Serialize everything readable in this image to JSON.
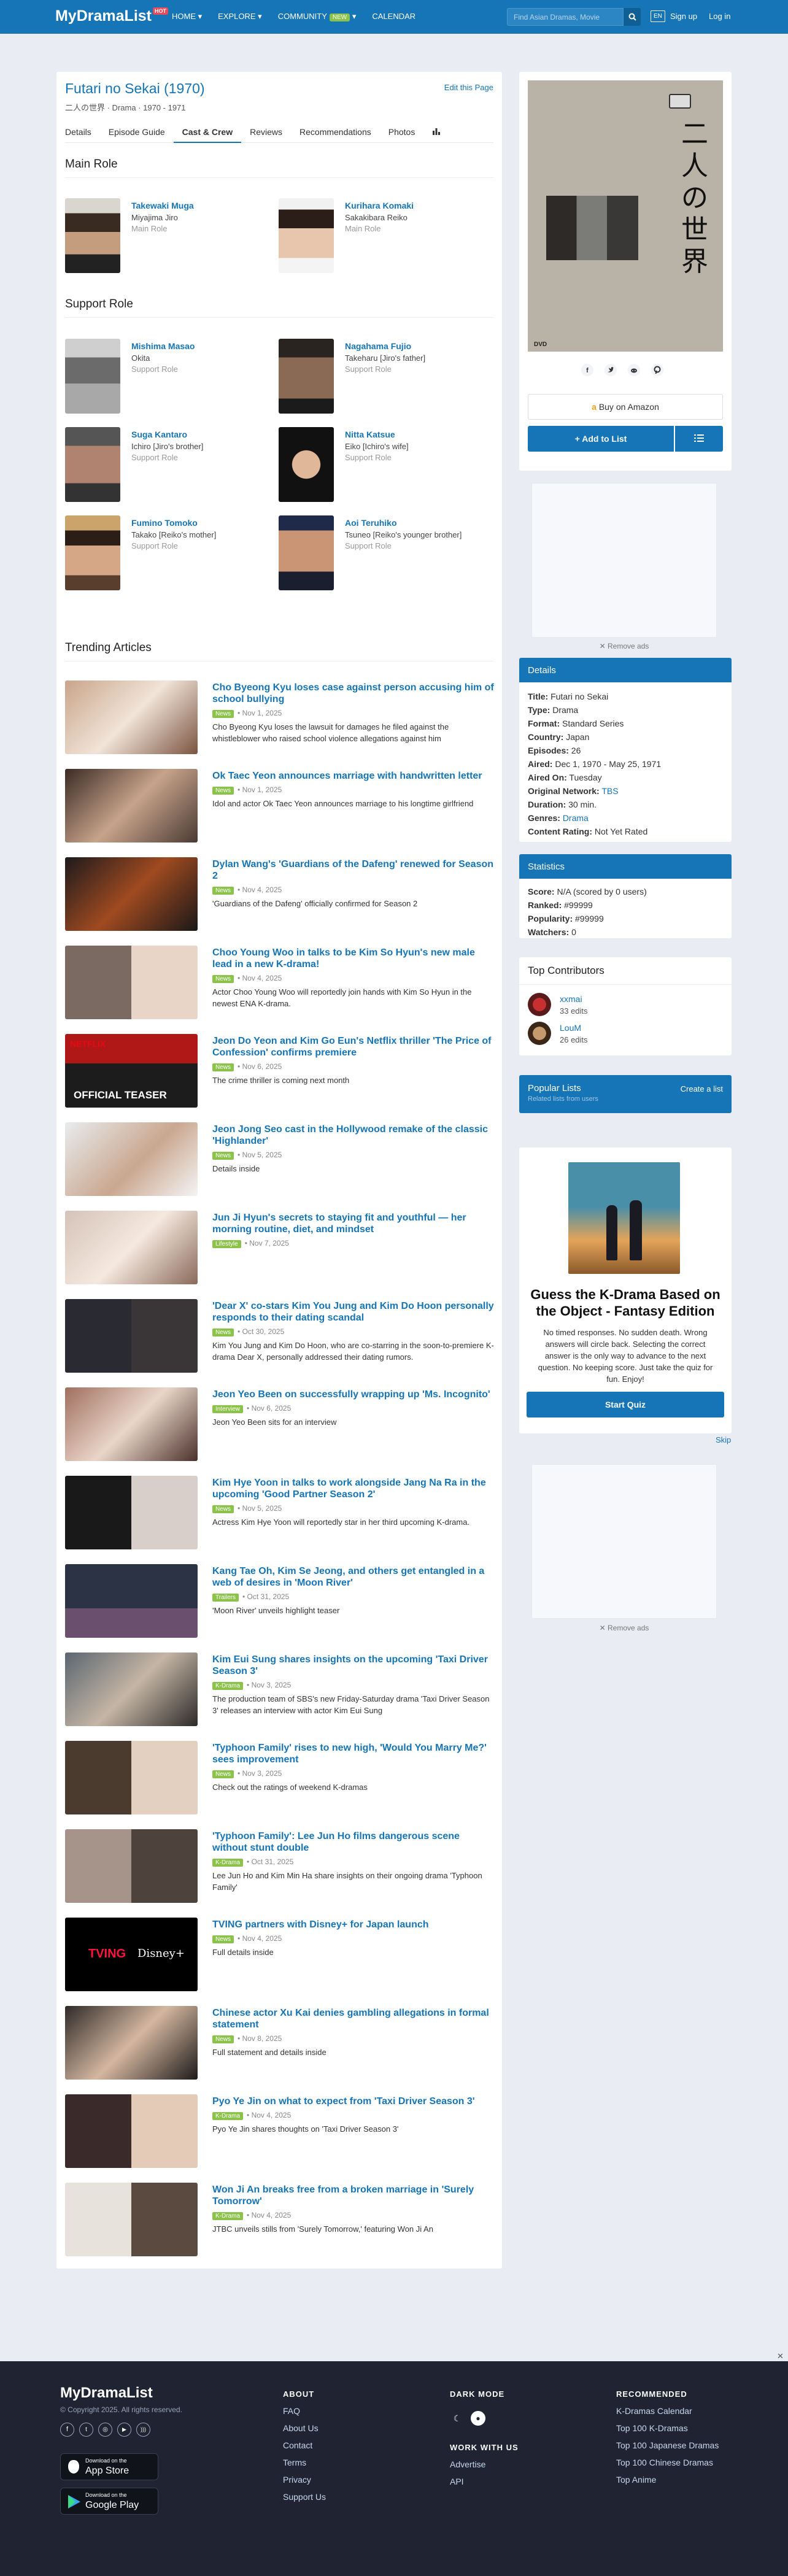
{
  "nav": {
    "logo": "MyDramaList",
    "logo_badge": "HOT",
    "home": "HOME ▾",
    "explore": "EXPLORE ▾",
    "community": "COMMUNITY",
    "community_badge": "NEW",
    "calendar": "CALENDAR",
    "search_placeholder": "Find Asian Dramas, Movie",
    "lang": "EN",
    "signup": "Sign up",
    "login": "Log in"
  },
  "drama": {
    "title": "Futari no Sekai (1970)",
    "subtitle": "二人の世界 · Drama · 1970 - 1971",
    "edit": "Edit this Page"
  },
  "tabs": [
    "Details",
    "Episode Guide",
    "Cast & Crew",
    "Reviews",
    "Recommendations",
    "Photos"
  ],
  "main_role_heading": "Main Role",
  "main_roles": [
    {
      "name": "Takewaki Muga",
      "character": "Miyajima Jiro",
      "role": "Main Role"
    },
    {
      "name": "Kurihara Komaki",
      "character": "Sakakibara Reiko",
      "role": "Main Role"
    }
  ],
  "support_role_heading": "Support Role",
  "support_roles": [
    {
      "name": "Mishima Masao",
      "character": "Okita",
      "role": "Support Role"
    },
    {
      "name": "Nagahama Fujio",
      "character": "Takeharu [Jiro's father]",
      "role": "Support Role"
    },
    {
      "name": "Suga Kantaro",
      "character": "Ichiro [Jiro's brother]",
      "role": "Support Role"
    },
    {
      "name": "Nitta Katsue",
      "character": "Eiko [Ichiro's wife]",
      "role": "Support Role"
    },
    {
      "name": "Fumino Tomoko",
      "character": "Takako [Reiko's mother]",
      "role": "Support Role"
    },
    {
      "name": "Aoi Teruhiko",
      "character": "Tsuneo [Reiko's younger brother]",
      "role": "Support Role"
    }
  ],
  "trending_heading": "Trending Articles",
  "articles": [
    {
      "title": "Cho Byeong Kyu loses case against person accusing him of school bullying",
      "cat": "News",
      "date": "Nov 1, 2025",
      "desc": "Cho Byeong Kyu loses the lawsuit for damages he filed against the whistleblower who raised school violence allegations against him"
    },
    {
      "title": "Ok Taec Yeon announces marriage with handwritten letter",
      "cat": "News",
      "date": "Nov 1, 2025",
      "desc": "Idol and actor Ok Taec Yeon announces marriage to his longtime girlfriend"
    },
    {
      "title": "Dylan Wang's 'Guardians of the Dafeng' renewed for Season 2",
      "cat": "News",
      "date": "Nov 4, 2025",
      "desc": "'Guardians of the Dafeng' officially confirmed for Season 2"
    },
    {
      "title": "Choo Young Woo in talks to be Kim So Hyun's new male lead in a new K-drama!",
      "cat": "News",
      "date": "Nov 4, 2025",
      "desc": "Actor Choo Young Woo will reportedly join hands with Kim So Hyun in the newest ENA K-drama."
    },
    {
      "title": "Jeon Do Yeon and Kim Go Eun's Netflix thriller 'The Price of Confession' confirms premiere",
      "cat": "News",
      "date": "Nov 6, 2025",
      "desc": "The crime thriller is coming next month"
    },
    {
      "title": "Jeon Jong Seo cast in the Hollywood remake of the classic 'Highlander'",
      "cat": "News",
      "date": "Nov 5, 2025",
      "desc": "Details inside"
    },
    {
      "title": "Jun Ji Hyun's secrets to staying fit and youthful — her morning routine, diet, and mindset",
      "cat": "Lifestyle",
      "date": "Nov 7, 2025",
      "desc": ""
    },
    {
      "title": "'Dear X' co-stars Kim You Jung and Kim Do Hoon personally responds to their dating scandal",
      "cat": "News",
      "date": "Oct 30, 2025",
      "desc": "Kim You Jung and Kim Do Hoon, who are co-starring in the soon-to-premiere K-drama Dear X, personally addressed their dating rumors."
    },
    {
      "title": "Jeon Yeo Been on successfully wrapping up 'Ms. Incognito'",
      "cat": "Interview",
      "date": "Nov 6, 2025",
      "desc": "Jeon Yeo Been sits for an interview"
    },
    {
      "title": "Kim Hye Yoon in talks to work alongside Jang Na Ra in the upcoming 'Good Partner Season 2'",
      "cat": "News",
      "date": "Nov 5, 2025",
      "desc": "Actress Kim Hye Yoon will reportedly star in her third upcoming K-drama."
    },
    {
      "title": "Kang Tae Oh, Kim Se Jeong, and others get entangled in a web of desires in 'Moon River'",
      "cat": "Trailers",
      "date": "Oct 31, 2025",
      "desc": "'Moon River' unveils highlight teaser"
    },
    {
      "title": "Kim Eui Sung shares insights on the upcoming 'Taxi Driver Season 3'",
      "cat": "K-Drama",
      "date": "Nov 3, 2025",
      "desc": "The production team of SBS's new Friday-Saturday drama 'Taxi Driver Season 3' releases an interview with actor Kim Eui Sung"
    },
    {
      "title": "'Typhoon Family' rises to new high, 'Would You Marry Me?' sees improvement",
      "cat": "News",
      "date": "Nov 3, 2025",
      "desc": "Check out the ratings of weekend K-dramas"
    },
    {
      "title": "'Typhoon Family': Lee Jun Ho films dangerous scene without stunt double",
      "cat": "K-Drama",
      "date": "Oct 31, 2025",
      "desc": "Lee Jun Ho and Kim Min Ha share insights on their ongoing drama 'Typhoon Family'"
    },
    {
      "title": "TVING partners with Disney+ for Japan launch",
      "cat": "News",
      "date": "Nov 4, 2025",
      "desc": "Full details inside"
    },
    {
      "title": "Chinese actor Xu Kai denies gambling allegations in formal statement",
      "cat": "News",
      "date": "Nov 8, 2025",
      "desc": "Full statement and details inside"
    },
    {
      "title": "Pyo Ye Jin on what to expect from 'Taxi Driver Season 3'",
      "cat": "K-Drama",
      "date": "Nov 4, 2025",
      "desc": "Pyo Ye Jin shares thoughts on 'Taxi Driver Season 3'"
    },
    {
      "title": "Won Ji An breaks free from a broken marriage in 'Surely Tomorrow'",
      "cat": "K-Drama",
      "date": "Nov 4, 2025",
      "desc": "JTBC unveils stills from 'Surely Tomorrow,' featuring Won Ji An"
    }
  ],
  "poster": {
    "vertical_text": "二人の世界"
  },
  "buy_label": "Buy on Amazon",
  "add_list_label": "+ Add to List",
  "remove_ads": "✕ Remove ads",
  "details": {
    "heading": "Details",
    "rows": [
      {
        "k": "Title:",
        "v": "Futari no Sekai"
      },
      {
        "k": "Type:",
        "v": "Drama"
      },
      {
        "k": "Format:",
        "v": "Standard Series"
      },
      {
        "k": "Country:",
        "v": "Japan"
      },
      {
        "k": "Episodes:",
        "v": "26"
      },
      {
        "k": "Aired:",
        "v": "Dec 1, 1970 - May 25, 1971"
      },
      {
        "k": "Aired On:",
        "v": "Tuesday"
      },
      {
        "k": "Original Network:",
        "v": "TBS"
      },
      {
        "k": "Duration:",
        "v": "30 min."
      },
      {
        "k": "Genres:",
        "v": "Drama"
      },
      {
        "k": "Content Rating:",
        "v": "Not Yet Rated"
      }
    ]
  },
  "statistics": {
    "heading": "Statistics",
    "rows": [
      {
        "k": "Score:",
        "v": "N/A (scored by 0 users)"
      },
      {
        "k": "Ranked:",
        "v": "#99999"
      },
      {
        "k": "Popularity:",
        "v": "#99999"
      },
      {
        "k": "Watchers:",
        "v": "0"
      }
    ]
  },
  "contributors": {
    "heading": "Top Contributors",
    "items": [
      {
        "name": "xxmai",
        "edits": "33 edits"
      },
      {
        "name": "LouM",
        "edits": "26 edits"
      }
    ]
  },
  "popular_lists": {
    "heading": "Popular Lists",
    "sub": "Related lists from users",
    "create": "Create a list"
  },
  "quiz": {
    "title": "Guess the K-Drama Based on the Object - Fantasy Edition",
    "desc": "No timed responses. No sudden death. Wrong answers will circle back. Selecting the correct answer is the only way to advance to the next question. No keeping score. Just take the quiz for fun. Enjoy!",
    "button": "Start Quiz",
    "skip": "Skip"
  },
  "footer": {
    "logo": "MyDramaList",
    "copyright": "© Copyright 2025. All rights reserved.",
    "appstore_small": "Download on the",
    "appstore": "App Store",
    "gplay_small": "Download on the",
    "gplay": "Google Play",
    "about_heading": "ABOUT",
    "about": [
      "FAQ",
      "About Us",
      "Contact",
      "Terms",
      "Privacy",
      "Support Us"
    ],
    "dark_heading": "DARK MODE",
    "work_heading": "WORK WITH US",
    "work": [
      "Advertise",
      "API"
    ],
    "rec_heading": "RECOMMENDED",
    "rec": [
      "K-Dramas Calendar",
      "Top 100 K-Dramas",
      "Top 100 Japanese Dramas",
      "Top 100 Chinese Dramas",
      "Top Anime"
    ]
  },
  "colors": {
    "brand": "#1675b6",
    "footer": "#1f2332",
    "badge": "#8bc34a"
  }
}
